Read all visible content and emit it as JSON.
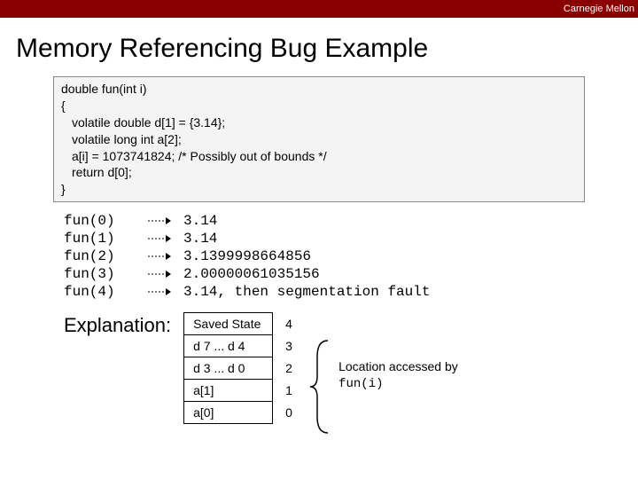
{
  "header": {
    "org": "Carnegie Mellon"
  },
  "title": "Memory Referencing Bug Example",
  "code": {
    "l0": "double fun(int i)",
    "l1": "{",
    "l2": "volatile double d[1] = {3.14};",
    "l3": "volatile long int a[2];",
    "l4": "a[i] = 1073741824; /* Possibly out of bounds */",
    "l5": "return d[0];",
    "l6": "}"
  },
  "results": [
    {
      "call": "fun(0)",
      "value": "3.14"
    },
    {
      "call": "fun(1)",
      "value": "3.14"
    },
    {
      "call": "fun(2)",
      "value": "3.1399998664856"
    },
    {
      "call": "fun(3)",
      "value": "2.00000061035156"
    },
    {
      "call": "fun(4)",
      "value": "3.14, then segmentation fault"
    }
  ],
  "explanation_label": "Explanation:",
  "mem": [
    {
      "label": "Saved State",
      "index": "4"
    },
    {
      "label": "d 7 ... d 4",
      "index": "3"
    },
    {
      "label": "d 3 ... d 0",
      "index": "2"
    },
    {
      "label": "a[1]",
      "index": "1"
    },
    {
      "label": "a[0]",
      "index": "0"
    }
  ],
  "annotation": {
    "line1": "Location accessed by",
    "line2": "fun(i)"
  },
  "chart_data": {
    "type": "table",
    "title": "Memory Referencing Bug Example",
    "calls": [
      {
        "i": 0,
        "returns": "3.14"
      },
      {
        "i": 1,
        "returns": "3.14"
      },
      {
        "i": 2,
        "returns": "3.1399998664856"
      },
      {
        "i": 3,
        "returns": "2.00000061035156"
      },
      {
        "i": 4,
        "returns": "3.14, then segmentation fault"
      }
    ],
    "stack_layout": [
      {
        "offset": 4,
        "contents": "Saved State"
      },
      {
        "offset": 3,
        "contents": "d7 ... d4"
      },
      {
        "offset": 2,
        "contents": "d3 ... d0"
      },
      {
        "offset": 1,
        "contents": "a[1]"
      },
      {
        "offset": 0,
        "contents": "a[0]"
      }
    ]
  }
}
